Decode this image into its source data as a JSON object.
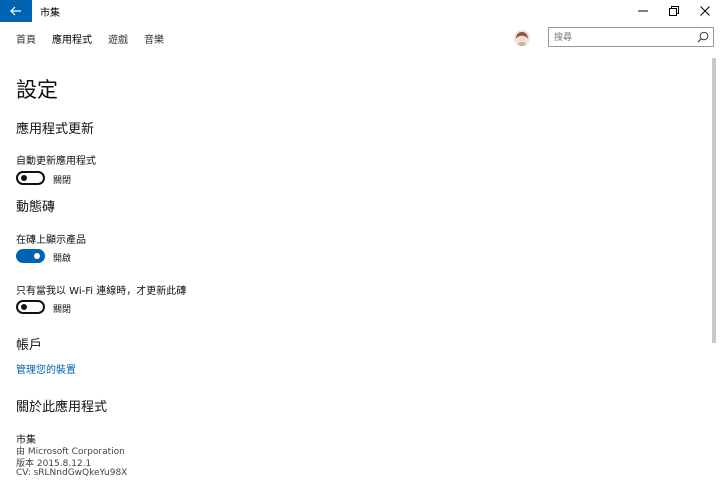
{
  "window": {
    "title": "市集"
  },
  "nav": {
    "items": [
      "首頁",
      "應用程式",
      "遊戲",
      "音樂"
    ]
  },
  "search": {
    "placeholder": "搜尋"
  },
  "page": {
    "title": "設定"
  },
  "sections": {
    "app_updates": {
      "heading": "應用程式更新",
      "setting_label": "自動更新應用程式",
      "state": "關閉"
    },
    "live_tile": {
      "heading": "動態磚",
      "show_products_label": "在磚上顯示產品",
      "show_products_state": "開啟",
      "wifi_only_label": "只有當我以 Wi-Fi 連線時，才更新此磚",
      "wifi_only_state": "關閉"
    },
    "account": {
      "heading": "帳戶",
      "manage_devices_link": "管理您的裝置"
    },
    "about": {
      "heading": "關於此應用程式",
      "app_name": "市集",
      "publisher": "由 Microsoft Corporation",
      "version": "版本 2015.8.12.1",
      "cv": "CV: sRLNndGwQkeYu98X"
    }
  },
  "colors": {
    "accent": "#0063b1",
    "toggle_off": "#111111",
    "scrollbar": "#c8c8c8"
  },
  "icons": {
    "back": "back-arrow-icon",
    "minimize": "minimize-icon",
    "restore": "restore-icon",
    "close": "close-icon",
    "search": "search-icon"
  }
}
